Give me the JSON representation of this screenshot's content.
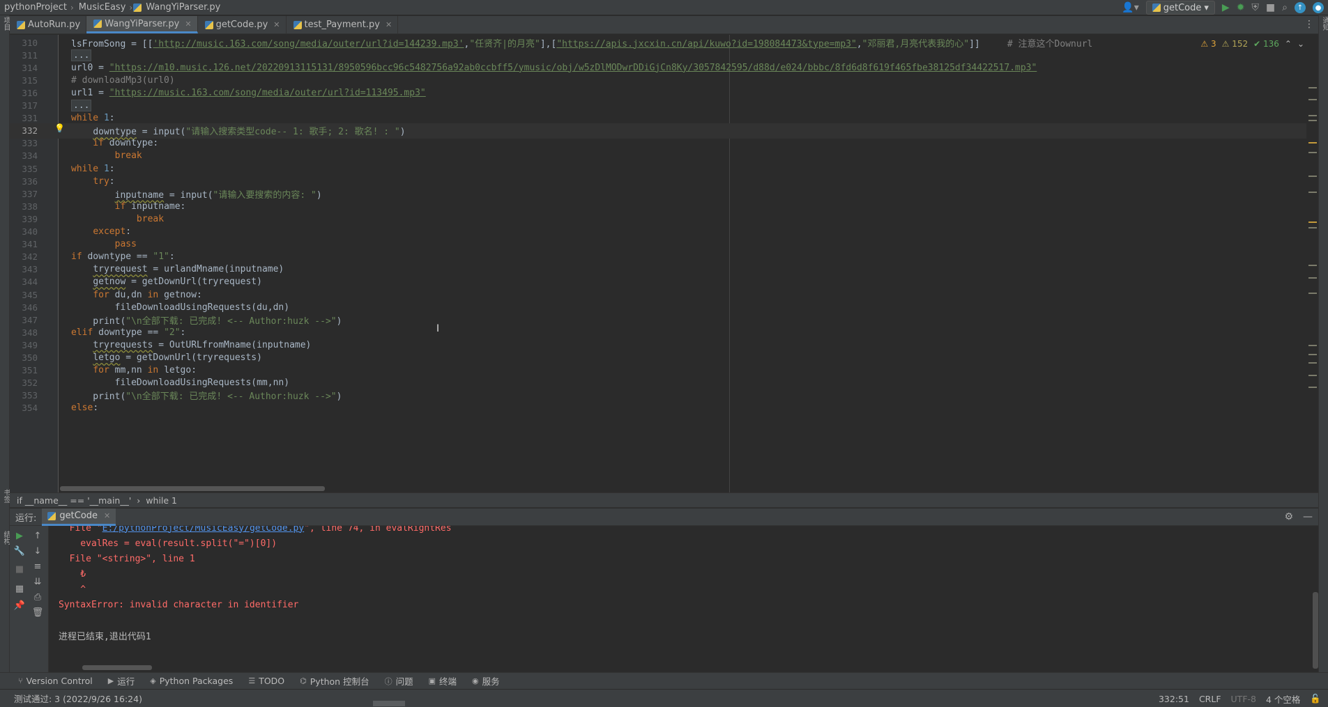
{
  "navbar": {
    "crumbs": [
      "pythonProject",
      "MusicEasy",
      "WangYiParser.py"
    ],
    "run_config": "getCode"
  },
  "left_stripe": [
    "项目",
    "书签",
    "结构"
  ],
  "right_stripe": [
    "通知"
  ],
  "tabs": [
    {
      "label": "AutoRun.py"
    },
    {
      "label": "WangYiParser.py"
    },
    {
      "label": "getCode.py"
    },
    {
      "label": "test_Payment.py"
    }
  ],
  "editor": {
    "inspection": {
      "warnings": "3",
      "weak": "152",
      "ok": "136"
    },
    "lines": [
      {
        "n": "310",
        "parts": [
          [
            "",
            "lsFromSong = [["
          ],
          [
            "url",
            "'http://music.163.com/song/media/outer/url?id=144239.mp3'"
          ],
          [
            "",
            ","
          ],
          [
            "str",
            "\"任贤齐|的月亮\""
          ],
          [
            "",
            "],["
          ],
          [
            "url",
            "\"https://apis.jxcxin.cn/api/kuwo?id=198084473&type=mp3\""
          ],
          [
            "",
            ","
          ],
          [
            "str",
            "\"邓丽君,月亮代表我的心\""
          ],
          [
            "",
            "]]     "
          ],
          [
            "cm",
            "# 注意这个Downurl"
          ]
        ]
      },
      {
        "n": "311",
        "parts": [
          [
            "fold",
            "..."
          ]
        ]
      },
      {
        "n": "314",
        "parts": [
          [
            "",
            "url0 = "
          ],
          [
            "url",
            "\"https://m10.music.126.net/20220913115131/8950596bcc96c5482756a92ab0ccbff5/ymusic/obj/w5zDlMODwrDDiGjCn8Ky/3057842595/d88d/e024/bbbc/8fd6d8f619f465fbe38125df34422517.mp3\""
          ]
        ]
      },
      {
        "n": "315",
        "parts": [
          [
            "cm",
            "# downloadMp3(url0)"
          ]
        ]
      },
      {
        "n": "316",
        "parts": [
          [
            "",
            "url1 = "
          ],
          [
            "url",
            "\"https://music.163.com/song/media/outer/url?id=113495.mp3\""
          ]
        ]
      },
      {
        "n": "317",
        "parts": [
          [
            "fold",
            "..."
          ]
        ]
      },
      {
        "n": "331",
        "parts": [
          [
            "kw",
            "while "
          ],
          [
            "num",
            "1"
          ],
          [
            "",
            ":"
          ]
        ]
      },
      {
        "n": "332",
        "parts": [
          [
            "",
            "    "
          ],
          [
            "warn",
            "downtype"
          ],
          [
            "",
            " = input("
          ],
          [
            "str",
            "\"请输入搜索类型code-- 1: 歌手; 2: 歌名! : \""
          ],
          [
            "",
            ")"
          ]
        ],
        "current": true
      },
      {
        "n": "333",
        "parts": [
          [
            "",
            "    "
          ],
          [
            "kw",
            "if "
          ],
          [
            "",
            "downtype:"
          ]
        ]
      },
      {
        "n": "334",
        "parts": [
          [
            "",
            "        "
          ],
          [
            "kw",
            "break"
          ]
        ]
      },
      {
        "n": "335",
        "parts": [
          [
            "kw",
            "while "
          ],
          [
            "num",
            "1"
          ],
          [
            "",
            ":"
          ]
        ]
      },
      {
        "n": "336",
        "parts": [
          [
            "",
            "    "
          ],
          [
            "kw",
            "try"
          ],
          [
            "",
            ":"
          ]
        ]
      },
      {
        "n": "337",
        "parts": [
          [
            "",
            "        "
          ],
          [
            "warn",
            "inputname"
          ],
          [
            "",
            " = input("
          ],
          [
            "str",
            "\"请输入要搜索的内容: \""
          ],
          [
            "",
            ")"
          ]
        ]
      },
      {
        "n": "338",
        "parts": [
          [
            "",
            "        "
          ],
          [
            "kw",
            "if "
          ],
          [
            "",
            "inputname:"
          ]
        ]
      },
      {
        "n": "339",
        "parts": [
          [
            "",
            "            "
          ],
          [
            "kw",
            "break"
          ]
        ]
      },
      {
        "n": "340",
        "parts": [
          [
            "",
            "    "
          ],
          [
            "kw",
            "except"
          ],
          [
            "",
            ":"
          ]
        ]
      },
      {
        "n": "341",
        "parts": [
          [
            "",
            "        "
          ],
          [
            "kw",
            "pass"
          ]
        ]
      },
      {
        "n": "342",
        "parts": [
          [
            "kw",
            "if "
          ],
          [
            "",
            "downtype == "
          ],
          [
            "str",
            "\"1\""
          ],
          [
            "",
            ":"
          ]
        ]
      },
      {
        "n": "343",
        "parts": [
          [
            "",
            "    "
          ],
          [
            "warn",
            "tryrequest"
          ],
          [
            "",
            " = urlandMname(inputname)"
          ]
        ]
      },
      {
        "n": "344",
        "parts": [
          [
            "",
            "    "
          ],
          [
            "warn",
            "getnow"
          ],
          [
            "",
            " = getDownUrl(tryrequest)"
          ]
        ]
      },
      {
        "n": "345",
        "parts": [
          [
            "",
            "    "
          ],
          [
            "kw",
            "for "
          ],
          [
            "",
            "du,dn "
          ],
          [
            "kw",
            "in "
          ],
          [
            "",
            "getnow:"
          ]
        ]
      },
      {
        "n": "346",
        "parts": [
          [
            "",
            "        fileDownloadUsingRequests(du,dn)"
          ]
        ]
      },
      {
        "n": "347",
        "parts": [
          [
            "",
            "    print("
          ],
          [
            "str",
            "\"\\n全部下载: 已完成! <-- Author:huzk -->\""
          ],
          [
            "",
            ")"
          ]
        ]
      },
      {
        "n": "348",
        "parts": [
          [
            "kw",
            "elif "
          ],
          [
            "",
            "downtype == "
          ],
          [
            "str",
            "\"2\""
          ],
          [
            "",
            ":"
          ]
        ]
      },
      {
        "n": "349",
        "parts": [
          [
            "",
            "    "
          ],
          [
            "warn",
            "tryrequests"
          ],
          [
            "",
            " = OutURLfromMname(inputname)"
          ]
        ]
      },
      {
        "n": "350",
        "parts": [
          [
            "",
            "    "
          ],
          [
            "warn",
            "letgo"
          ],
          [
            "",
            " = getDownUrl(tryrequests)"
          ]
        ]
      },
      {
        "n": "351",
        "parts": [
          [
            "",
            "    "
          ],
          [
            "kw",
            "for "
          ],
          [
            "",
            "mm,nn "
          ],
          [
            "kw",
            "in "
          ],
          [
            "",
            "letgo:"
          ]
        ]
      },
      {
        "n": "352",
        "parts": [
          [
            "",
            "        fileDownloadUsingRequests(mm,nn)"
          ]
        ]
      },
      {
        "n": "353",
        "parts": [
          [
            "",
            "    print("
          ],
          [
            "str",
            "\"\\n全部下载: 已完成! <-- Author:huzk -->\""
          ],
          [
            "",
            ")"
          ]
        ]
      },
      {
        "n": "354",
        "parts": [
          [
            "kw",
            "else"
          ],
          [
            "",
            ":"
          ]
        ]
      }
    ]
  },
  "editor_breadcrumb": [
    "if __name__ == '__main__'",
    "while 1"
  ],
  "run_panel": {
    "title": "运行:",
    "tab": "getCode",
    "console": [
      {
        "type": "err",
        "text_a": "  File \"",
        "link": "E:/pythonProject/MusicEasy/getCode.py",
        "text_b": "\", line 74, in evalRightRes"
      },
      {
        "type": "err",
        "text": "    evalRes = eval(result.split(\"=\")[0])"
      },
      {
        "type": "err",
        "text": "  File \"<string>\", line 1"
      },
      {
        "type": "err",
        "text": "    ₺"
      },
      {
        "type": "err",
        "text": "    ^"
      },
      {
        "type": "err",
        "text": "SyntaxError: invalid character in identifier"
      },
      {
        "type": "blank",
        "text": ""
      },
      {
        "type": "normal",
        "text": "进程已结束,退出代码1"
      }
    ]
  },
  "tool_windows": [
    {
      "icon": "branch-icon",
      "label": "Version Control"
    },
    {
      "icon": "run-icon",
      "label": "运行"
    },
    {
      "icon": "packages-icon",
      "label": "Python Packages"
    },
    {
      "icon": "todo-icon",
      "label": "TODO"
    },
    {
      "icon": "python-console-icon",
      "label": "Python 控制台"
    },
    {
      "icon": "problems-icon",
      "label": "问题"
    },
    {
      "icon": "terminal-icon",
      "label": "终端"
    },
    {
      "icon": "services-icon",
      "label": "服务"
    }
  ],
  "status": {
    "message": "测试通过: 3 (2022/9/26 16:24)",
    "position": "332:51",
    "line_sep": "CRLF",
    "encoding": "UTF-8",
    "indent": "4 个空格"
  }
}
